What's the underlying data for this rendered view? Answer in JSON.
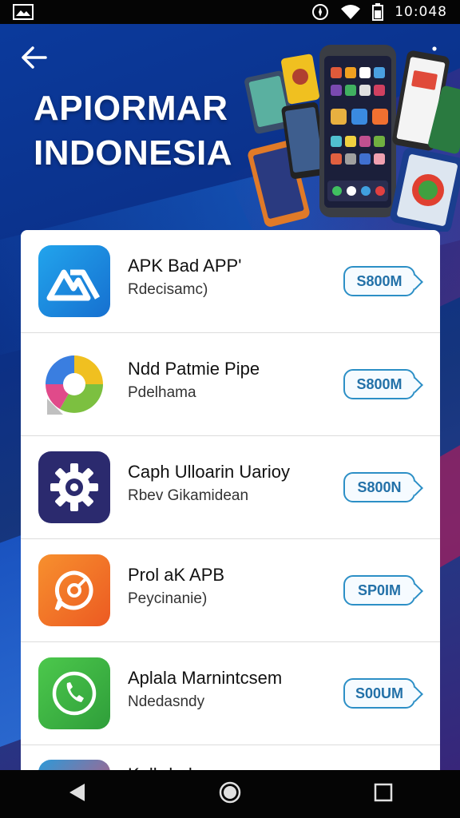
{
  "status_bar": {
    "time": "10:048",
    "icons": [
      "image-icon",
      "compass-icon",
      "wifi-icon",
      "battery-icon"
    ]
  },
  "header": {
    "title_line1": "APIORMAR",
    "title_line2": "INDONESIA",
    "back_icon": "arrow-left-icon",
    "menu_icon": "more-vertical-icon"
  },
  "apps": [
    {
      "name": "APK Bad APP'",
      "subtitle": "Rdecisamc)",
      "button": "S800M",
      "icon": "mountain-logo-icon",
      "color": "#1f8fe0"
    },
    {
      "name": "Ndd Patmie Pipe",
      "subtitle": "Pdelhama",
      "button": "S800M",
      "icon": "chrome-like-icon",
      "color": "#e8b020"
    },
    {
      "name": "Caph Ulloarin Uarioy",
      "subtitle": "Rbev Gikamidean",
      "button": "S800N",
      "icon": "gear-icon",
      "color": "#2b2a6e"
    },
    {
      "name": "Prol aK APB",
      "subtitle": "Peycinanie)",
      "button": "SP0IM",
      "icon": "chat-bubble-icon",
      "color": "#f07028"
    },
    {
      "name": "Aplala Marnintcsem",
      "subtitle": "Ndedasndy",
      "button": "S00UM",
      "icon": "phone-icon",
      "color": "#3cb044"
    },
    {
      "name": "Kalhdnrh",
      "subtitle": "",
      "button": "",
      "icon": "partial-app-icon",
      "color": "#2d9ad8"
    }
  ],
  "nav": {
    "back_icon": "nav-back-icon",
    "home_icon": "nav-home-icon",
    "recents_icon": "nav-recents-icon"
  }
}
